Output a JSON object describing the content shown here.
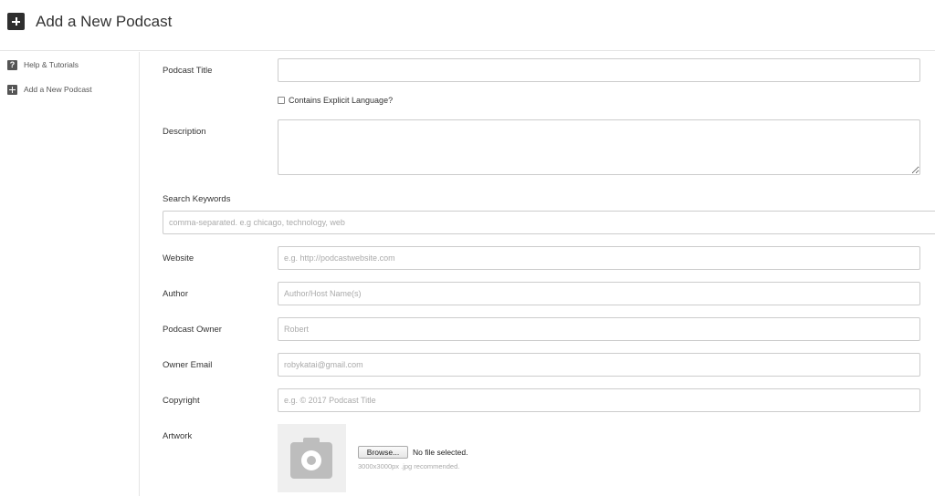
{
  "header": {
    "title": "Add a New Podcast",
    "icon": "plus-square-icon"
  },
  "sidebar": {
    "items": [
      {
        "label": "Help & Tutorials",
        "icon": "question-icon",
        "icon_text": "?"
      },
      {
        "label": "Add a New Podcast",
        "icon": "plus-icon"
      }
    ]
  },
  "form": {
    "podcast_title": {
      "label": "Podcast Title",
      "value": "",
      "placeholder": ""
    },
    "explicit": {
      "label": "Contains Explicit Language?",
      "checked": false
    },
    "description": {
      "label": "Description",
      "value": ""
    },
    "search_keywords": {
      "label": "Search Keywords",
      "placeholder": "comma-separated. e.g chicago, technology, web"
    },
    "website": {
      "label": "Website",
      "placeholder": "e.g. http://podcastwebsite.com"
    },
    "author": {
      "label": "Author",
      "placeholder": "Author/Host Name(s)"
    },
    "podcast_owner": {
      "label": "Podcast Owner",
      "placeholder": "Robert"
    },
    "owner_email": {
      "label": "Owner Email",
      "placeholder": "robykatai@gmail.com"
    },
    "copyright": {
      "label": "Copyright",
      "placeholder": "e.g. © 2017 Podcast Title"
    },
    "artwork": {
      "label": "Artwork",
      "icon": "camera-icon",
      "browse_label": "Browse...",
      "file_status": "No file selected.",
      "hint": "3000x3000px .jpg recommended."
    }
  }
}
